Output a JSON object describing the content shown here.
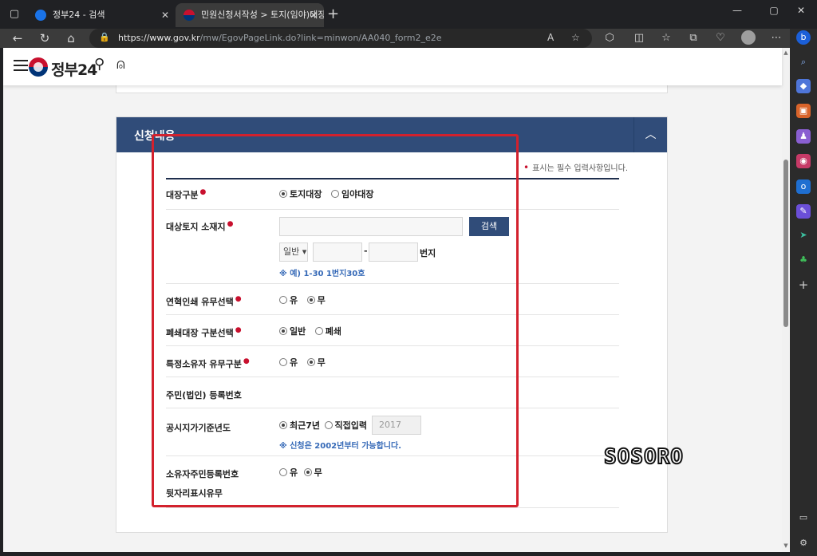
{
  "browser": {
    "tabs": [
      {
        "title": "정부24 - 검색",
        "active": false
      },
      {
        "title": "민원신청서작성 > 토지(임야)대장",
        "active": true
      }
    ],
    "url_host": "https://www.gov.kr",
    "url_path": "/mw/EgovPageLink.do?link=minwon/AA040_form2_e2e"
  },
  "site": {
    "logo_text": "정부24"
  },
  "form": {
    "section_title": "신청내용",
    "required_note": "표시는 필수 입력사항입니다.",
    "rows": {
      "ledger_type": {
        "label": "대장구분",
        "options": [
          "토지대장",
          "임야대장"
        ],
        "selected": "토지대장"
      },
      "location": {
        "label": "대상토지 소재지",
        "address_value": "",
        "search_button": "검색",
        "land_type": "일반",
        "lot_separator": "-",
        "lot_unit": "번지",
        "hint": "※ 예) 1-30 1번지30호"
      },
      "history_print": {
        "label": "연혁인쇄 유무선택",
        "options": [
          "유",
          "무"
        ],
        "selected": "무"
      },
      "closed_ledger": {
        "label": "폐쇄대장 구분선택",
        "options": [
          "일반",
          "폐쇄"
        ],
        "selected": "일반"
      },
      "special_owner": {
        "label": "특정소유자 유무구분",
        "options": [
          "유",
          "무"
        ],
        "selected": "무"
      },
      "resident_no": {
        "label": "주민(법인) 등록번호"
      },
      "price_year": {
        "label": "공시지가기준년도",
        "options": [
          "최근7년",
          "직접입력"
        ],
        "selected": "최근7년",
        "year_value": "2017",
        "hint": "※ 신청은 2002년부터 가능합니다."
      },
      "owner_id_display": {
        "label_line1": "소유자주민등록번호",
        "label_line2": "뒷자리표시유무",
        "options": [
          "유",
          "무"
        ],
        "selected": "무"
      }
    }
  },
  "watermark": "SOSORO",
  "colors": {
    "panel_header": "#304c79",
    "highlight": "#d3212d",
    "required": "#c8102e",
    "hint": "#3569b7"
  }
}
